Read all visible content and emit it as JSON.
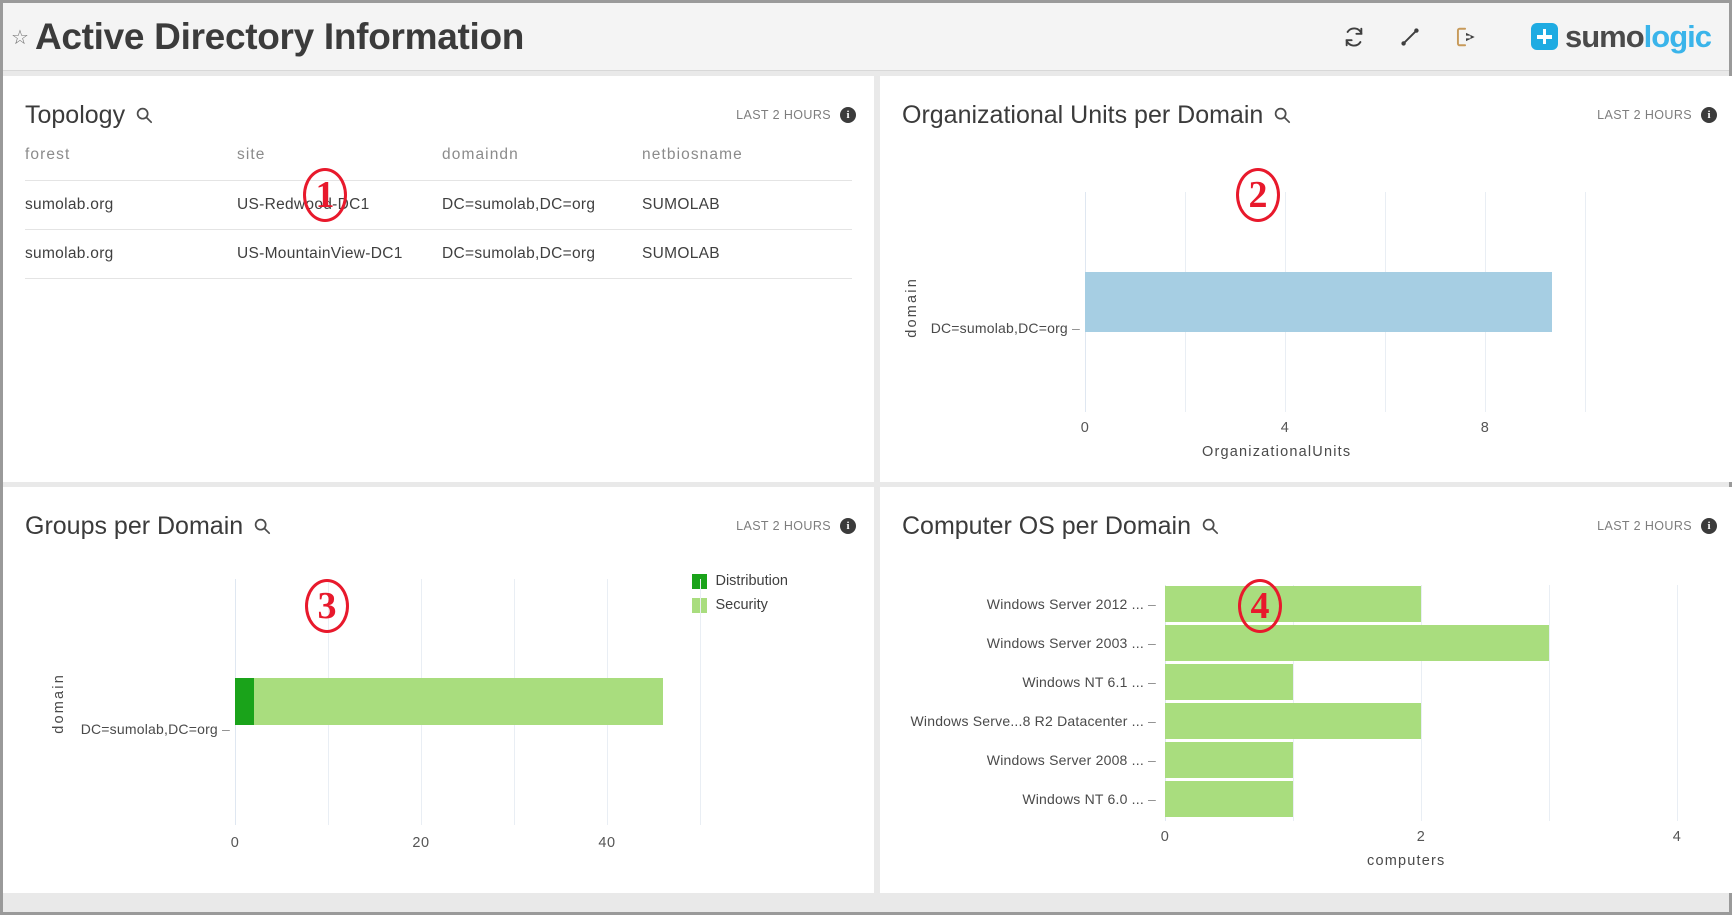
{
  "header": {
    "title": "Active Directory Information",
    "star_icon": "star-outline-icon",
    "tools": [
      {
        "name": "refresh-icon",
        "label": "Refresh"
      },
      {
        "name": "expand-icon",
        "label": "Expand"
      },
      {
        "name": "export-icon",
        "label": "Export"
      }
    ],
    "logo": {
      "primary": "sumo",
      "secondary": "logic"
    }
  },
  "common": {
    "time_range": "LAST 2 HOURS",
    "info_glyph": "i",
    "search_icon": "magnifier-icon"
  },
  "panels": [
    {
      "badge": "1",
      "title": "Topology",
      "type": "table"
    },
    {
      "badge": "2",
      "title": "Organizational Units per Domain",
      "type": "bar"
    },
    {
      "badge": "3",
      "title": "Groups per Domain",
      "type": "stacked-bar"
    },
    {
      "badge": "4",
      "title": "Computer OS per Domain",
      "type": "bar"
    }
  ],
  "topology_table": {
    "columns": [
      "forest",
      "site",
      "domaindn",
      "netbiosname"
    ],
    "rows": [
      [
        "sumolab.org",
        "US-Redwood-DC1",
        "DC=sumolab,DC=org",
        "SUMOLAB"
      ],
      [
        "sumolab.org",
        "US-MountainView-DC1",
        "DC=sumolab,DC=org",
        "SUMOLAB"
      ]
    ]
  },
  "chart_data": [
    {
      "id": "organizational-units-per-domain",
      "type": "bar",
      "orientation": "horizontal",
      "title": "Organizational Units per Domain",
      "categories": [
        "DC=sumolab,DC=org"
      ],
      "values": [
        9
      ],
      "xlabel": "OrganizationalUnits",
      "ylabel": "domain",
      "xlim": [
        0,
        10
      ],
      "xticks": [
        0,
        4,
        8
      ],
      "xtick_labels": [
        "0",
        "4",
        "8"
      ],
      "gridlines": [
        0,
        2,
        4,
        6,
        8,
        10
      ],
      "grid": true,
      "legend": null,
      "colors": [
        "#a6cee3"
      ]
    },
    {
      "id": "groups-per-domain",
      "type": "bar",
      "orientation": "horizontal",
      "stacked": true,
      "title": "Groups per Domain",
      "categories": [
        "DC=sumolab,DC=org"
      ],
      "series": [
        {
          "name": "Distribution",
          "values": [
            2
          ],
          "color": "#1aa31a"
        },
        {
          "name": "Security",
          "values": [
            44
          ],
          "color": "#a9dd7e"
        }
      ],
      "xlabel": "",
      "ylabel": "domain",
      "xlim": [
        0,
        50
      ],
      "xticks": [
        0,
        20,
        40
      ],
      "xtick_labels": [
        "0",
        "20",
        "40"
      ],
      "gridlines": [
        0,
        10,
        20,
        30,
        40,
        50
      ],
      "grid": true,
      "legend": {
        "position": "top-right",
        "entries": [
          "Distribution",
          "Security"
        ]
      }
    },
    {
      "id": "computer-os-per-domain",
      "type": "bar",
      "orientation": "horizontal",
      "title": "Computer OS per Domain",
      "categories": [
        "Windows Server 2012 ...",
        "Windows Server 2003 ...",
        "Windows NT 6.1 ...",
        "Windows Serve...8 R2 Datacenter ...",
        "Windows Server 2008 ...",
        "Windows NT 6.0 ..."
      ],
      "values": [
        2,
        3,
        1,
        2,
        1,
        1
      ],
      "xlabel": "computers",
      "ylabel": "",
      "xlim": [
        0,
        4
      ],
      "xticks": [
        0,
        2,
        4
      ],
      "xtick_labels": [
        "0",
        "2",
        "4"
      ],
      "gridlines": [
        0,
        1,
        2,
        3,
        4
      ],
      "grid": true,
      "legend": null,
      "colors": [
        "#a9dd7e"
      ]
    }
  ]
}
